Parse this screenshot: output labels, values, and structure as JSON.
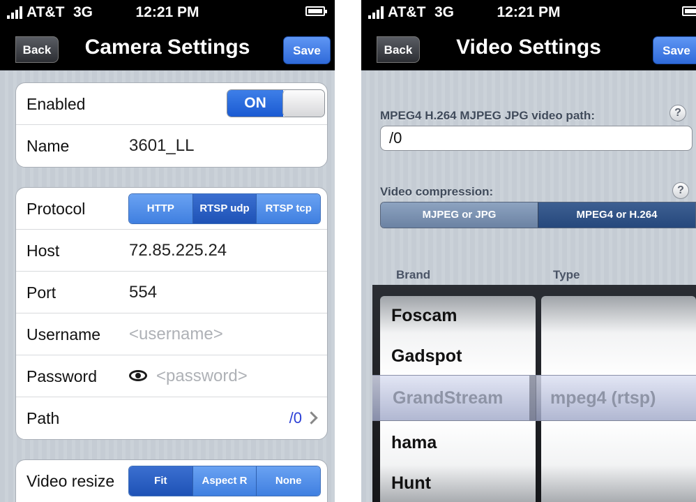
{
  "left_screen": {
    "status_bar": {
      "carrier": "AT&T",
      "network": "3G",
      "time": "12:21 PM"
    },
    "nav": {
      "back_label": "Back",
      "title": "Camera Settings",
      "save_label": "Save"
    },
    "enabled": {
      "label": "Enabled",
      "toggle_label": "ON",
      "value": true
    },
    "name": {
      "label": "Name",
      "value": "3601_LL"
    },
    "protocol": {
      "label": "Protocol",
      "options": [
        "HTTP",
        "RTSP udp",
        "RTSP tcp"
      ],
      "selected": "RTSP udp"
    },
    "host": {
      "label": "Host",
      "value": "72.85.225.24"
    },
    "port": {
      "label": "Port",
      "value": "554"
    },
    "username": {
      "label": "Username",
      "placeholder": "<username>"
    },
    "password": {
      "label": "Password",
      "placeholder": "<password>"
    },
    "path": {
      "label": "Path",
      "value": "/0"
    },
    "video_resize": {
      "label": "Video resize",
      "options": [
        "Fit",
        "Aspect R",
        "None"
      ],
      "selected": "Fit"
    }
  },
  "right_screen": {
    "status_bar": {
      "carrier": "AT&T",
      "network": "3G",
      "time": "12:21 PM"
    },
    "nav": {
      "back_label": "Back",
      "title": "Video Settings",
      "save_label": "Save"
    },
    "video_path": {
      "label": "MPEG4 H.264 MJPEG JPG video path:",
      "value": "/0",
      "help": "?"
    },
    "compression": {
      "label": "Video compression:",
      "help": "?",
      "options": [
        "MJPEG or JPG",
        "MPEG4 or H.264"
      ],
      "selected": "MPEG4 or H.264"
    },
    "picker": {
      "brand_header": "Brand",
      "type_header": "Type",
      "brands": [
        "Foscam",
        "Gadspot",
        "GrandStream",
        "hama",
        "Hunt"
      ],
      "selected_brand": "GrandStream",
      "selected_type": "mpeg4 (rtsp)"
    }
  },
  "colors": {
    "accent": "#2f6ad9",
    "background": "#c5ccd4",
    "navbar": "#000000",
    "link": "#2b3fd6"
  },
  "icons": [
    "signal-bars-icon",
    "battery-icon",
    "back-arrow-icon",
    "eye-icon",
    "chevron-right-icon",
    "help-icon"
  ]
}
